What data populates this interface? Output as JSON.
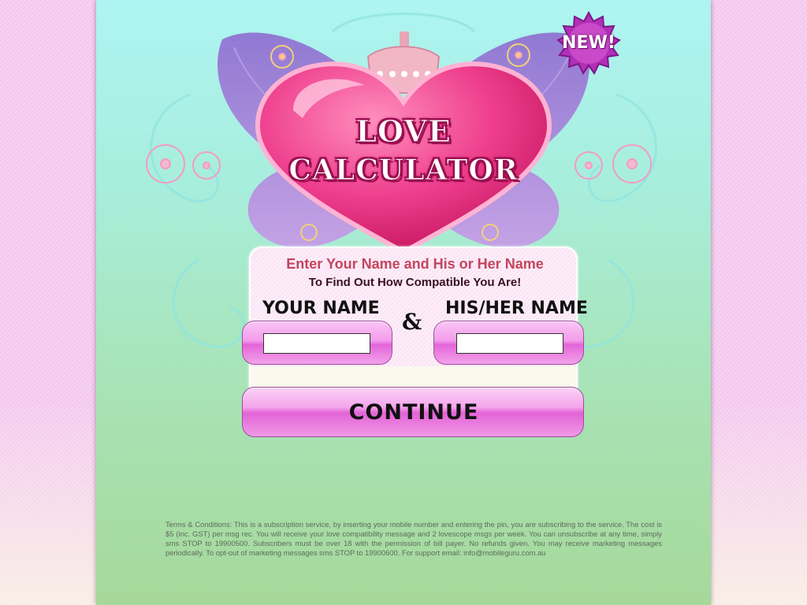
{
  "colors": {
    "page_background": "#f4c6ef",
    "panel_top": "#aef4f2",
    "panel_bottom": "#a6d89a",
    "heart_pink": "#ee3d8c",
    "butterfly_purple": "#9b6dc6",
    "button_pink": "#e465d8",
    "headline_red": "#c2455c"
  },
  "badge": {
    "text": "NEW!",
    "icon": "starburst-badge-icon"
  },
  "header": {
    "title_line1": "LOVE",
    "title_line2": "CALCULATOR",
    "icons": [
      "heart-icon",
      "butterfly-icon",
      "crown-icon",
      "flower-icon"
    ]
  },
  "form": {
    "headline": "Enter Your Name and His or Her Name",
    "subheadline": "To Find Out How Compatible You Are!",
    "your_name_label": "YOUR NAME",
    "their_name_label": "HIS/HER NAME",
    "ampersand": "&",
    "your_name_value": "",
    "their_name_value": "",
    "continue_label": "CONTINUE"
  },
  "footer": {
    "terms": "Terms & Conditions: This is a subscription service, by inserting your mobile number and entering the pin, you are subscribing to the service. The cost is $5 (inc. GST) per msg rec. You will receive your love compatibility message and 2 lovescope msgs per week. You can unsubscribe at any time, simply sms STOP to 19900500. Subscribers must be over 18 with the permission of bill payer. No refunds given. You may receive marketing messages periodically. To opt-out of marketing messages sms STOP to 19900600. For support email: info@mobileguru.com.au"
  }
}
